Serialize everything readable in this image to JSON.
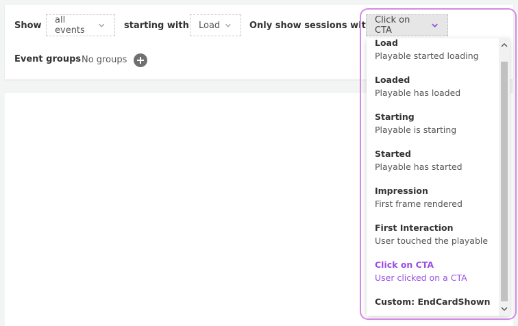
{
  "filters": {
    "show_label": "Show",
    "show_value": "all events",
    "starting_label": "starting with",
    "starting_value": "Load",
    "sessions_label": "Only show sessions with:",
    "sessions_value": "Click on CTA"
  },
  "groups": {
    "label": "Event groups",
    "value": "No groups"
  },
  "menu": {
    "items": [
      {
        "title": "Load",
        "desc": "Playable started loading"
      },
      {
        "title": "Loaded",
        "desc": "Playable has loaded"
      },
      {
        "title": "Starting",
        "desc": "Playable is starting"
      },
      {
        "title": "Started",
        "desc": "Playable has started"
      },
      {
        "title": "Impression",
        "desc": "First frame rendered"
      },
      {
        "title": "First Interaction",
        "desc": "User touched the playable"
      },
      {
        "title": "Click on CTA",
        "desc": "User clicked on a CTA"
      },
      {
        "title": "Custom: EndCardShown",
        "desc": ""
      }
    ]
  },
  "colors": {
    "accent": "#9a4ee6",
    "highlight_border": "#d18ae6"
  },
  "icons": {
    "dropdown": "chevron-down-icon",
    "add": "plus-icon"
  }
}
